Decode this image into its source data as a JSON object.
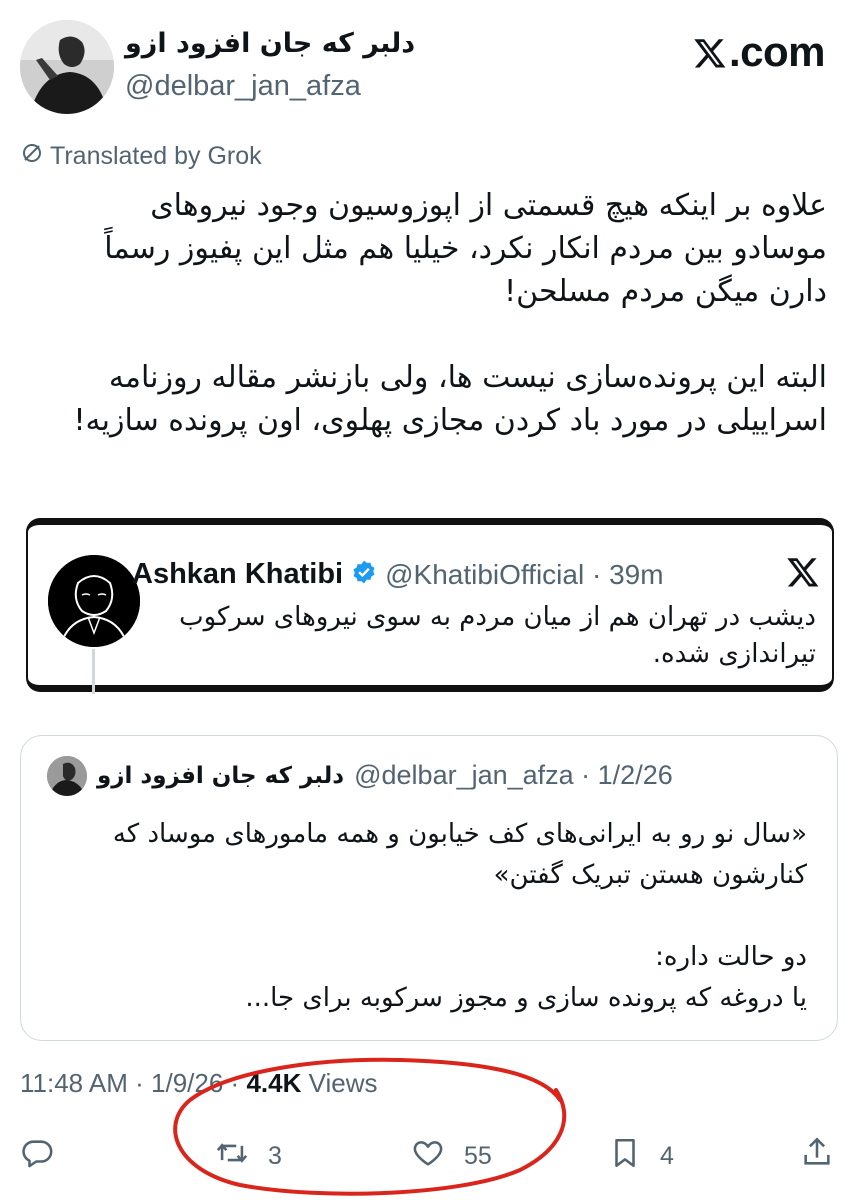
{
  "author": {
    "display_name": "دلبر که جان افزود ازو",
    "handle": "@delbar_jan_afza"
  },
  "brand": {
    "label": ".com",
    "icon": "x-logo-icon"
  },
  "translated_label": "Translated by Grok",
  "tweet_text": "علاوه بر اینکه هیچ قسمتی از اپوزوسیون وجود نیروهای\nموسادو بین مردم انکار نکرد، خیلیا هم مثل این پفیوز رسماً\nدارن میگن مردم مسلحن!\n\nالبته این پرونده‌سازی نیست ها، ولی بازنشر مقاله روزنامه\nاسراییلی در مورد باد کردن مجازی پهلوی، اون پرونده سازیه!",
  "embedded_post": {
    "name": "Ashkan Khatibi",
    "verified": true,
    "meta": "@KhatibiOfficial · 39m",
    "text": "دیشب در تهران هم از میان مردم به سوی نیروهای سرکوب\nتیراندازی شده."
  },
  "quoted_post": {
    "name": "دلبر که جان افزود ازو",
    "meta": "@delbar_jan_afza · 1/2/26",
    "text": "«سال نو رو به ایرانی‌های کف خیابون و همه مامورهای موساد که\nکنارشون هستن تبریک گفتن»\n\nدو حالت داره:\nیا دروغه که پرونده سازی و مجوز سرکوبه برای جا..."
  },
  "timestamp": {
    "time_date": "11:48 AM · 1/9/26 ·",
    "views_count": "4.4K",
    "views_label": "Views"
  },
  "actions": {
    "reply_count": "",
    "repost_count": "3",
    "like_count": "55",
    "bookmark_count": "4"
  },
  "colors": {
    "text": "#0f1419",
    "secondary": "#536471",
    "verified": "#1d9bf0",
    "annotation": "#d9251c",
    "border": "#cfd9de"
  }
}
